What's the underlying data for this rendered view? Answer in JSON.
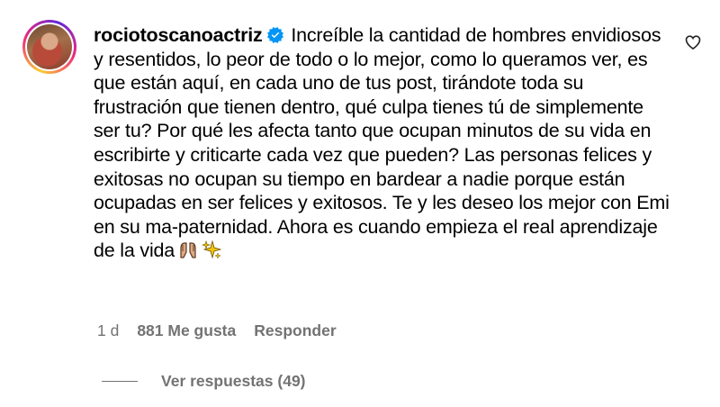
{
  "comment": {
    "username": "rociotoscanoactriz",
    "verified": true,
    "text": "Increíble la cantidad de hombres envidiosos y resentidos, lo peor de todo o lo mejor, como lo queramos ver, es que están aquí, en cada uno de tus post, tirándote toda su frustración que tienen dentro, qué culpa tienes tú de simplemente ser tu? Por qué les afecta tanto que ocupan minutos de su vida en escribirte y criticarte cada vez que pueden? Las personas felices y exitosas no ocupan su tiempo en bardear a nadie porque están ocupadas en ser felices y exitosos. Te y les deseo los mejor con Emi en su ma-paternidad. Ahora es cuando empieza el real aprendizaje de la vida",
    "emoji": [
      "raising-hands-emoji",
      "sparkles-emoji"
    ],
    "time": "1 d",
    "likes": "881 Me gusta",
    "reply_label": "Responder",
    "view_replies": "Ver respuestas (49)"
  },
  "colors": {
    "text": "#000000",
    "meta": "#737373",
    "verified": "#0095f6",
    "sparkle": "#f4c20d"
  },
  "icons": {
    "like": "heart-outline-icon",
    "verified": "verified-badge-icon"
  }
}
